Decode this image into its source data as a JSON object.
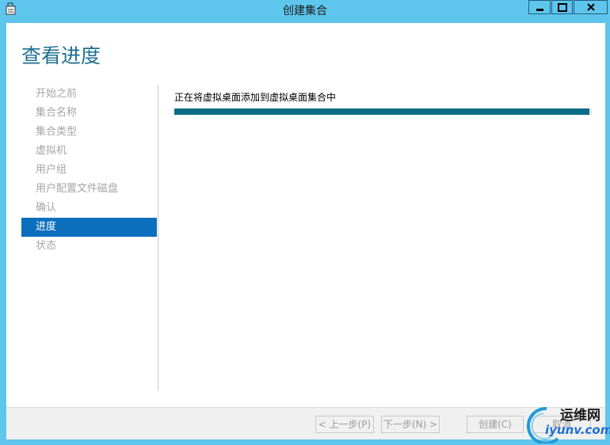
{
  "window": {
    "title": "创建集合",
    "icon": "app-document-icon"
  },
  "page": {
    "title": "查看进度"
  },
  "nav": {
    "items": [
      {
        "label": "开始之前",
        "active": false
      },
      {
        "label": "集合名称",
        "active": false
      },
      {
        "label": "集合类型",
        "active": false
      },
      {
        "label": "虚拟机",
        "active": false
      },
      {
        "label": "用户组",
        "active": false
      },
      {
        "label": "用户配置文件磁盘",
        "active": false
      },
      {
        "label": "确认",
        "active": false
      },
      {
        "label": "进度",
        "active": true
      },
      {
        "label": "状态",
        "active": false
      }
    ]
  },
  "main": {
    "status_text": "正在将虚拟桌面添加到虚拟桌面集合中",
    "progress_fraction": 0.995
  },
  "footer": {
    "prev_label": "< 上一步(P)",
    "next_label": "下一步(N) >",
    "create_label": "创建(C)",
    "cancel_label": "取消"
  },
  "watermark": {
    "name": "运维网",
    "url": "iyunv.com"
  },
  "colors": {
    "titlebar": "#5ec5ec",
    "active_nav": "#0b6fbd",
    "progress": "#0c6e86",
    "page_title": "#1e6f8f"
  }
}
